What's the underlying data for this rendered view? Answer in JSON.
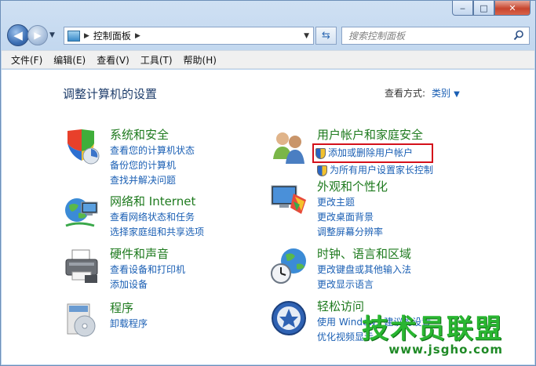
{
  "window": {
    "caption_buttons": [
      "‒",
      "□",
      "✕"
    ]
  },
  "address": {
    "crumb": "控制面板",
    "search_placeholder": "搜索控制面板"
  },
  "menu": [
    "文件(F)",
    "编辑(E)",
    "查看(V)",
    "工具(T)",
    "帮助(H)"
  ],
  "content": {
    "heading": "调整计算机的设置",
    "view_by_label": "查看方式:",
    "view_by_value": "类别"
  },
  "categories": [
    {
      "title": "系统和安全",
      "icon": "shield-computer-icon",
      "links": [
        "查看您的计算机状态",
        "备份您的计算机",
        "查找并解决问题"
      ]
    },
    {
      "title": "网络和 Internet",
      "icon": "network-globe-icon",
      "links": [
        "查看网络状态和任务",
        "选择家庭组和共享选项"
      ]
    },
    {
      "title": "硬件和声音",
      "icon": "printer-icon",
      "links": [
        "查看设备和打印机",
        "添加设备"
      ]
    },
    {
      "title": "程序",
      "icon": "program-disc-icon",
      "links": [
        "卸载程序"
      ]
    },
    {
      "title": "用户帐户和家庭安全",
      "icon": "users-icon",
      "links": [
        "添加或删除用户帐户",
        "为所有用户设置家长控制"
      ]
    },
    {
      "title": "外观和个性化",
      "icon": "display-palette-icon",
      "links": [
        "更改主题",
        "更改桌面背景",
        "调整屏幕分辨率"
      ]
    },
    {
      "title": "时钟、语言和区域",
      "icon": "clock-globe-icon",
      "links": [
        "更改键盘或其他输入法",
        "更改显示语言"
      ]
    },
    {
      "title": "轻松访问",
      "icon": "ease-of-access-icon",
      "links": [
        "使用 Windows 建议的设置",
        "优化视频显示"
      ]
    }
  ],
  "watermark": {
    "title": "技术员联盟",
    "url": "www.jsgho.com"
  },
  "colors": {
    "link": "#1a5fb4",
    "category_title": "#1e7a1e",
    "highlight_border": "#d4101a"
  }
}
